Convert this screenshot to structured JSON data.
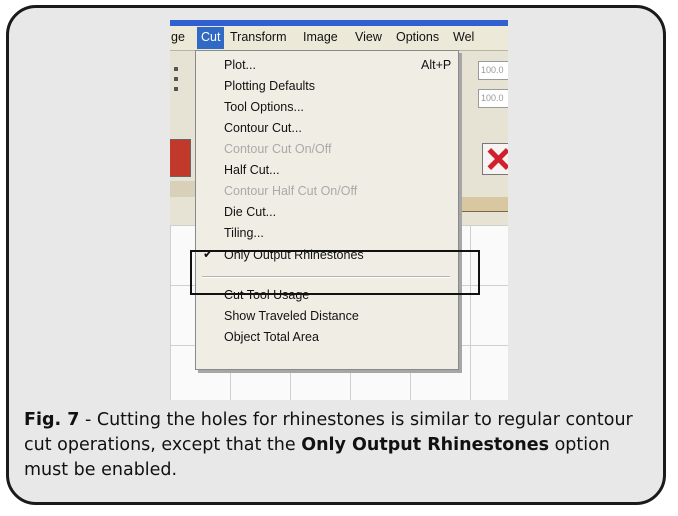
{
  "menubar": {
    "items": [
      {
        "label": "ge",
        "active": false
      },
      {
        "label": "Cut",
        "active": true
      },
      {
        "label": "Transform",
        "active": false
      },
      {
        "label": "Image",
        "active": false
      },
      {
        "label": "View",
        "active": false
      },
      {
        "label": "Options",
        "active": false
      },
      {
        "label": "Wel",
        "active": false
      }
    ]
  },
  "toolbar": {
    "field_values": [
      "100.0",
      "100.0"
    ]
  },
  "cut_menu": {
    "plot": {
      "label": "Plot...",
      "shortcut": "Alt+P"
    },
    "plotting_defaults": "Plotting Defaults",
    "tool_options": "Tool Options...",
    "contour_cut": "Contour Cut...",
    "contour_cut_onoff": "Contour Cut On/Off",
    "half_cut": "Half Cut...",
    "contour_half_cut_onoff": "Contour Half Cut On/Off",
    "die_cut": "Die Cut...",
    "tiling": "Tiling...",
    "only_output_rhinestones": {
      "label": "Only Output Rhinestones",
      "checked": true
    },
    "cut_tool_usage": "Cut Tool Usage",
    "show_traveled_distance": "Show Traveled Distance",
    "object_total_area": "Object Total Area"
  },
  "caption": {
    "fig_label": "Fig. 7",
    "text_before": " - Cutting the holes for rhinestones is similar to regular contour cut operations, except that the ",
    "bold_option": "Only Output Rhinestones",
    "text_after": " option must be enabled."
  },
  "colors": {
    "menu_highlight": "#316ac5",
    "frame_border": "#1a1a1a",
    "frame_background": "#e8e8e8"
  }
}
